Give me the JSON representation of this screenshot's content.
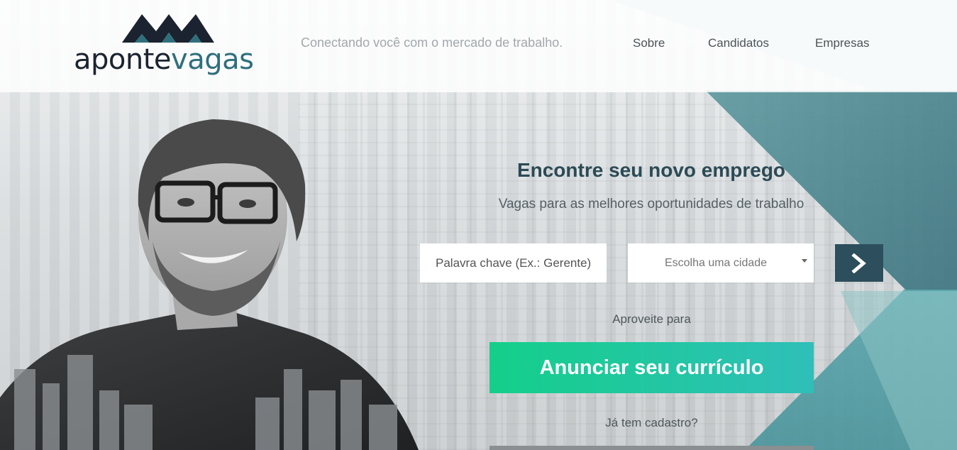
{
  "logo": {
    "part1": "aponte",
    "part2": "vagas",
    "colors": {
      "dark": "#1b2330",
      "teal": "#2f6f7c"
    }
  },
  "header": {
    "tagline": "Conectando você com o mercado de trabalho.",
    "nav": [
      {
        "label": "Sobre"
      },
      {
        "label": "Candidatos"
      },
      {
        "label": "Empresas"
      }
    ]
  },
  "hero": {
    "title": "Encontre seu novo emprego",
    "subtitle": "Vagas para as melhores oportunidades de trabalho",
    "search": {
      "keyword_placeholder": "Palavra chave (Ex.: Gerente)",
      "city_selected": "Escolha uma cidade",
      "submit_icon": "chevron-right-icon"
    },
    "aproveite": "Aproveite para",
    "cta_label": "Anunciar seu currículo",
    "ja_tem": "Já tem cadastro?"
  },
  "colors": {
    "accent_green": "#14cf8a",
    "accent_teal": "#2fbfb9",
    "dark_teal": "#2d4e5c",
    "title": "#2c4a55"
  }
}
